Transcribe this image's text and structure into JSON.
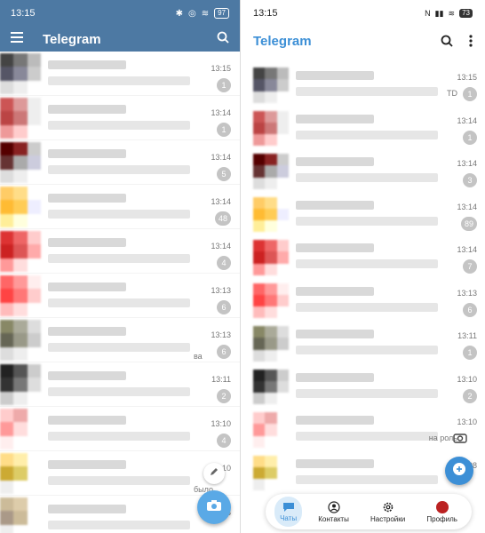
{
  "left": {
    "status_time": "13:15",
    "battery": "97",
    "app_title": "Telegram",
    "colors": {
      "header": "#4d79a3",
      "fab": "#5aa9e6",
      "badge": "#c4c4c4"
    },
    "rows": [
      {
        "time": "13:15",
        "badge": "1",
        "frag": ""
      },
      {
        "time": "13:14",
        "badge": "1",
        "frag": ""
      },
      {
        "time": "13:14",
        "badge": "5",
        "frag": ""
      },
      {
        "time": "13:14",
        "badge": "48",
        "frag": ""
      },
      {
        "time": "13:14",
        "badge": "4",
        "frag": ""
      },
      {
        "time": "13:13",
        "badge": "6",
        "frag": ""
      },
      {
        "time": "13:13",
        "badge": "6",
        "frag": "ва"
      },
      {
        "time": "13:11",
        "badge": "2",
        "frag": ""
      },
      {
        "time": "13:10",
        "badge": "4",
        "frag": ""
      },
      {
        "time": "13:10",
        "badge": "",
        "frag": "было"
      },
      {
        "time": "13:08",
        "badge": "",
        "frag": ""
      }
    ]
  },
  "right": {
    "status_time": "13:15",
    "battery": "73",
    "app_title": "Telegram",
    "colors": {
      "title": "#3c8fd6",
      "fab": "#3c8fd6",
      "tab_active_bg": "#d9ebf9"
    },
    "rows": [
      {
        "time": "13:15",
        "badge": "1",
        "frag": "TD"
      },
      {
        "time": "13:14",
        "badge": "1",
        "frag": ""
      },
      {
        "time": "13:14",
        "badge": "3",
        "frag": ""
      },
      {
        "time": "13:14",
        "badge": "89",
        "frag": ""
      },
      {
        "time": "13:14",
        "badge": "7",
        "frag": ""
      },
      {
        "time": "13:13",
        "badge": "6",
        "frag": ""
      },
      {
        "time": "13:11",
        "badge": "1",
        "frag": ""
      },
      {
        "time": "13:10",
        "badge": "2",
        "frag": ""
      },
      {
        "time": "13:10",
        "badge": "",
        "frag": "на роль"
      },
      {
        "time": "13:08",
        "badge": "",
        "frag": ""
      }
    ],
    "tabs": [
      {
        "label": "Чаты",
        "icon": "chat-bubble-icon",
        "active": true
      },
      {
        "label": "Контакты",
        "icon": "contact-icon",
        "active": false
      },
      {
        "label": "Настройки",
        "icon": "gear-icon",
        "active": false
      },
      {
        "label": "Профиль",
        "icon": "profile-avatar-icon",
        "active": false
      }
    ]
  }
}
